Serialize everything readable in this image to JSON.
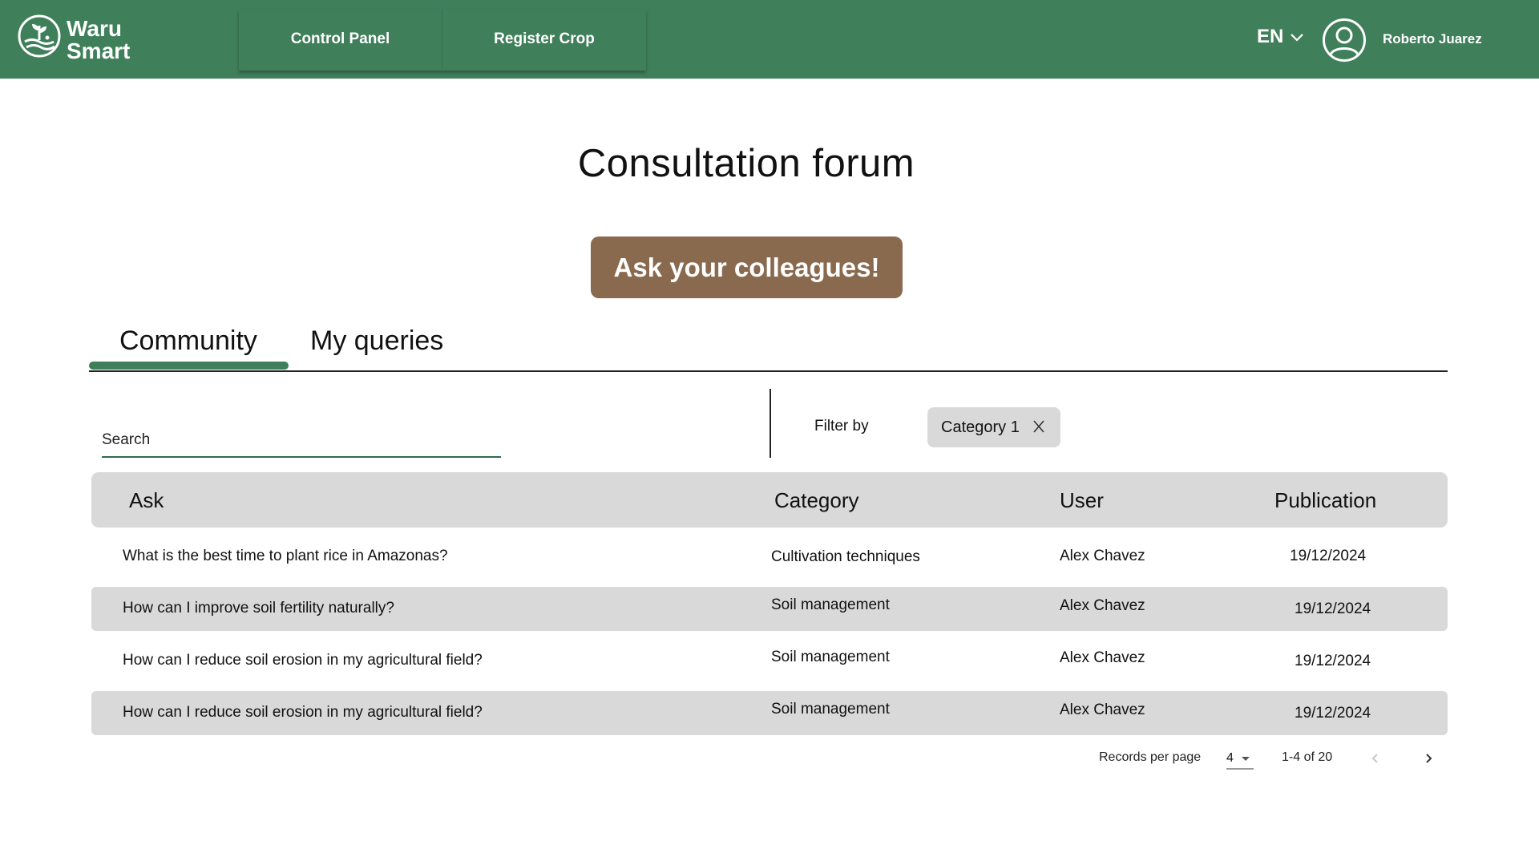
{
  "header": {
    "logo_line1": "Waru",
    "logo_line2": "Smart",
    "nav": [
      "Control Panel",
      "Register Crop"
    ],
    "language": "EN",
    "user_name": "Roberto Juarez",
    "bg_color": "#3f7f5a"
  },
  "main": {
    "title": "Consultation forum",
    "ask_button": "Ask your colleagues!",
    "tabs": [
      "Community",
      "My queries"
    ],
    "active_tab": "Community",
    "search_placeholder": "Search",
    "filter_label": "Filter by",
    "filter_chip": "Category 1",
    "accent_color": "#3f7f5a",
    "button_color": "#8a6a4f"
  },
  "table": {
    "headers": [
      "Ask",
      "Category",
      "User",
      "Publication"
    ],
    "rows": [
      {
        "ask": "What is the best time to plant rice in Amazonas?",
        "category": "Cultivation techniques",
        "user": "Alex Chavez",
        "publication": "19/12/2024"
      },
      {
        "ask": "How can I improve soil fertility naturally?",
        "category": "Soil management",
        "user": "Alex Chavez",
        "publication": "19/12/2024"
      },
      {
        "ask": "How can I reduce soil erosion in my agricultural field?",
        "category": "Soil management",
        "user": "Alex Chavez",
        "publication": "19/12/2024"
      },
      {
        "ask": "How can I reduce soil erosion in my agricultural field?",
        "category": "Soil management",
        "user": "Alex Chavez",
        "publication": "19/12/2024"
      }
    ]
  },
  "pagination": {
    "records_label": "Records per page",
    "records_value": "4",
    "range": "1-4 of 20"
  }
}
